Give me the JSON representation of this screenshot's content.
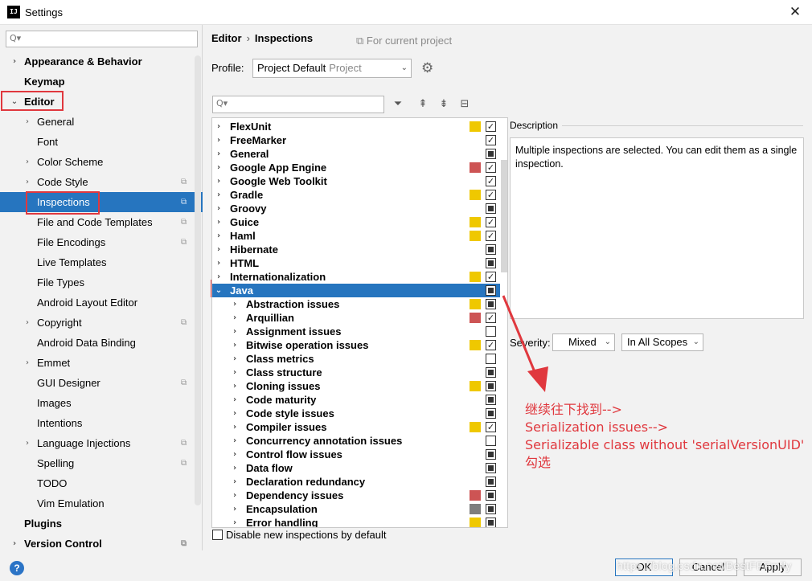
{
  "window": {
    "title": "Settings",
    "app_icon_text": "IJ",
    "close_icon": "close-icon"
  },
  "sidebar": {
    "search_placeholder": "Q▾",
    "items": [
      {
        "label": "Appearance & Behavior",
        "bold": true,
        "chevron": "›",
        "indent": 0,
        "proj": ""
      },
      {
        "label": "Keymap",
        "bold": true,
        "chevron": "",
        "indent": 0,
        "proj": ""
      },
      {
        "label": "Editor",
        "bold": true,
        "chevron": "⌄",
        "indent": 0,
        "proj": ""
      },
      {
        "label": "General",
        "bold": false,
        "chevron": "›",
        "indent": 1,
        "proj": ""
      },
      {
        "label": "Font",
        "bold": false,
        "chevron": "",
        "indent": 1,
        "proj": ""
      },
      {
        "label": "Color Scheme",
        "bold": false,
        "chevron": "›",
        "indent": 1,
        "proj": ""
      },
      {
        "label": "Code Style",
        "bold": false,
        "chevron": "›",
        "indent": 1,
        "proj": "⧉"
      },
      {
        "label": "Inspections",
        "bold": false,
        "chevron": "",
        "indent": 1,
        "proj": "⧉",
        "selected": true
      },
      {
        "label": "File and Code Templates",
        "bold": false,
        "chevron": "",
        "indent": 1,
        "proj": "⧉"
      },
      {
        "label": "File Encodings",
        "bold": false,
        "chevron": "",
        "indent": 1,
        "proj": "⧉"
      },
      {
        "label": "Live Templates",
        "bold": false,
        "chevron": "",
        "indent": 1,
        "proj": ""
      },
      {
        "label": "File Types",
        "bold": false,
        "chevron": "",
        "indent": 1,
        "proj": ""
      },
      {
        "label": "Android Layout Editor",
        "bold": false,
        "chevron": "",
        "indent": 1,
        "proj": ""
      },
      {
        "label": "Copyright",
        "bold": false,
        "chevron": "›",
        "indent": 1,
        "proj": "⧉"
      },
      {
        "label": "Android Data Binding",
        "bold": false,
        "chevron": "",
        "indent": 1,
        "proj": ""
      },
      {
        "label": "Emmet",
        "bold": false,
        "chevron": "›",
        "indent": 1,
        "proj": ""
      },
      {
        "label": "GUI Designer",
        "bold": false,
        "chevron": "",
        "indent": 1,
        "proj": "⧉"
      },
      {
        "label": "Images",
        "bold": false,
        "chevron": "",
        "indent": 1,
        "proj": ""
      },
      {
        "label": "Intentions",
        "bold": false,
        "chevron": "",
        "indent": 1,
        "proj": ""
      },
      {
        "label": "Language Injections",
        "bold": false,
        "chevron": "›",
        "indent": 1,
        "proj": "⧉"
      },
      {
        "label": "Spelling",
        "bold": false,
        "chevron": "",
        "indent": 1,
        "proj": "⧉"
      },
      {
        "label": "TODO",
        "bold": false,
        "chevron": "",
        "indent": 1,
        "proj": ""
      },
      {
        "label": "Vim Emulation",
        "bold": false,
        "chevron": "",
        "indent": 1,
        "proj": ""
      },
      {
        "label": "Plugins",
        "bold": true,
        "chevron": "",
        "indent": 0,
        "proj": ""
      },
      {
        "label": "Version Control",
        "bold": true,
        "chevron": "›",
        "indent": 0,
        "proj": "⧉"
      }
    ]
  },
  "breadcrumb": {
    "root": "Editor",
    "separator": "›",
    "current": "Inspections"
  },
  "for_project": "⧉ For current project",
  "profile": {
    "label": "Profile:",
    "value": "Project Default",
    "sub": "Project",
    "arrow": "⌄",
    "gear_icon": "⚙"
  },
  "inspection_toolbar": {
    "search_placeholder": "Q▾",
    "filter_icon": "⏷",
    "expand_icon": "⇞",
    "collapse_icon": "⇟",
    "reset_icon": "⊟"
  },
  "colors": {
    "yellow": "#efc800",
    "red": "#cd5454",
    "gray": "#7e7e7e",
    "selection": "#2675bf",
    "annotation": "#e0383e"
  },
  "inspections": [
    {
      "label": "FlexUnit",
      "indent": 0,
      "chevron": "›",
      "sev": "yellow",
      "cb": "checked"
    },
    {
      "label": "FreeMarker",
      "indent": 0,
      "chevron": "›",
      "sev": "",
      "cb": "checked"
    },
    {
      "label": "General",
      "indent": 0,
      "chevron": "›",
      "sev": "",
      "cb": "partial"
    },
    {
      "label": "Google App Engine",
      "indent": 0,
      "chevron": "›",
      "sev": "red",
      "cb": "checked"
    },
    {
      "label": "Google Web Toolkit",
      "indent": 0,
      "chevron": "›",
      "sev": "",
      "cb": "checked"
    },
    {
      "label": "Gradle",
      "indent": 0,
      "chevron": "›",
      "sev": "yellow",
      "cb": "checked"
    },
    {
      "label": "Groovy",
      "indent": 0,
      "chevron": "›",
      "sev": "",
      "cb": "partial"
    },
    {
      "label": "Guice",
      "indent": 0,
      "chevron": "›",
      "sev": "yellow",
      "cb": "checked"
    },
    {
      "label": "Haml",
      "indent": 0,
      "chevron": "›",
      "sev": "yellow",
      "cb": "checked"
    },
    {
      "label": "Hibernate",
      "indent": 0,
      "chevron": "›",
      "sev": "",
      "cb": "partial"
    },
    {
      "label": "HTML",
      "indent": 0,
      "chevron": "›",
      "sev": "",
      "cb": "partial"
    },
    {
      "label": "Internationalization",
      "indent": 0,
      "chevron": "›",
      "sev": "yellow",
      "cb": "checked"
    },
    {
      "label": "Java",
      "indent": 0,
      "chevron": "⌄",
      "sev": "",
      "cb": "partial",
      "selected": true
    },
    {
      "label": "Abstraction issues",
      "indent": 1,
      "chevron": "›",
      "sev": "yellow",
      "cb": "partial"
    },
    {
      "label": "Arquillian",
      "indent": 1,
      "chevron": "›",
      "sev": "red",
      "cb": "checked"
    },
    {
      "label": "Assignment issues",
      "indent": 1,
      "chevron": "›",
      "sev": "",
      "cb": "empty"
    },
    {
      "label": "Bitwise operation issues",
      "indent": 1,
      "chevron": "›",
      "sev": "yellow",
      "cb": "checked"
    },
    {
      "label": "Class metrics",
      "indent": 1,
      "chevron": "›",
      "sev": "",
      "cb": "empty"
    },
    {
      "label": "Class structure",
      "indent": 1,
      "chevron": "›",
      "sev": "",
      "cb": "partial"
    },
    {
      "label": "Cloning issues",
      "indent": 1,
      "chevron": "›",
      "sev": "yellow",
      "cb": "partial"
    },
    {
      "label": "Code maturity",
      "indent": 1,
      "chevron": "›",
      "sev": "",
      "cb": "partial"
    },
    {
      "label": "Code style issues",
      "indent": 1,
      "chevron": "›",
      "sev": "",
      "cb": "partial"
    },
    {
      "label": "Compiler issues",
      "indent": 1,
      "chevron": "›",
      "sev": "yellow",
      "cb": "checked"
    },
    {
      "label": "Concurrency annotation issues",
      "indent": 1,
      "chevron": "›",
      "sev": "",
      "cb": "empty"
    },
    {
      "label": "Control flow issues",
      "indent": 1,
      "chevron": "›",
      "sev": "",
      "cb": "partial"
    },
    {
      "label": "Data flow",
      "indent": 1,
      "chevron": "›",
      "sev": "",
      "cb": "partial"
    },
    {
      "label": "Declaration redundancy",
      "indent": 1,
      "chevron": "›",
      "sev": "",
      "cb": "partial"
    },
    {
      "label": "Dependency issues",
      "indent": 1,
      "chevron": "›",
      "sev": "red",
      "cb": "partial"
    },
    {
      "label": "Encapsulation",
      "indent": 1,
      "chevron": "›",
      "sev": "gray",
      "cb": "partial"
    },
    {
      "label": "Error handling",
      "indent": 1,
      "chevron": "›",
      "sev": "yellow",
      "cb": "partial"
    }
  ],
  "disable_new": "Disable new inspections by default",
  "description": {
    "title": "Description",
    "text": "Multiple inspections are selected. You can edit them as a single inspection."
  },
  "severity": {
    "label": "Severity:",
    "value": "Mixed",
    "scope": "In All Scopes",
    "arrow": "⌄"
  },
  "annotation": {
    "lines": [
      "继续往下找到-->",
      "Serialization issues-->",
      "Serializable class without 'serialVersionUID'",
      "勾选"
    ]
  },
  "footer": {
    "help": "?",
    "ok": "OK",
    "cancel": "Cancel",
    "apply": "Apply",
    "watermark": "https://blog.csdn.net/BestFFFmily"
  }
}
